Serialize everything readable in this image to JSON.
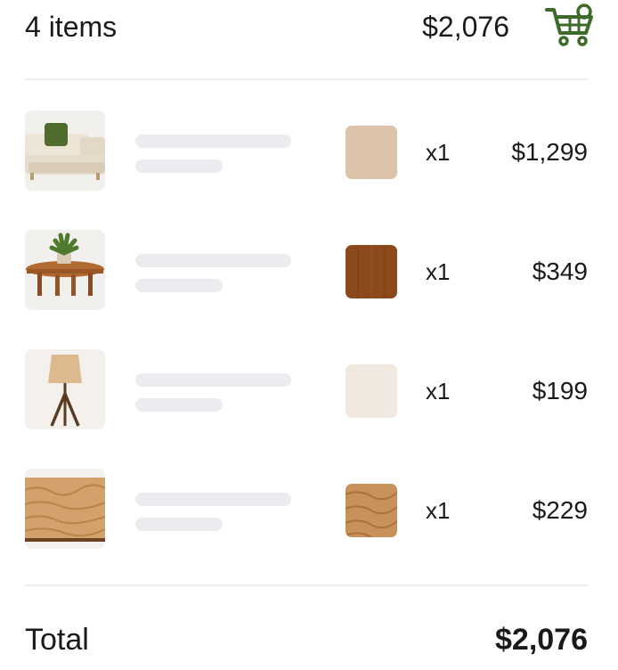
{
  "header": {
    "item_count": "4 items",
    "total": "$2,076",
    "cart_icon": "shopping-cart-icon",
    "accent": "#3e6b2c"
  },
  "items": [
    {
      "image": "sofa-thumbnail",
      "swatch_color": "#dcc3aa",
      "qty": "x1",
      "price": "$1,299"
    },
    {
      "image": "coffee-table-thumbnail",
      "swatch_color": "#8b4a1c",
      "qty": "x1",
      "price": "$349"
    },
    {
      "image": "floor-lamp-thumbnail",
      "swatch_color": "#f1e9df",
      "qty": "x1",
      "price": "$199"
    },
    {
      "image": "rug-thumbnail",
      "swatch_color": "#c8915a",
      "qty": "x1",
      "price": "$229"
    }
  ],
  "footer": {
    "total_label": "Total",
    "total_value": "$2,076"
  }
}
